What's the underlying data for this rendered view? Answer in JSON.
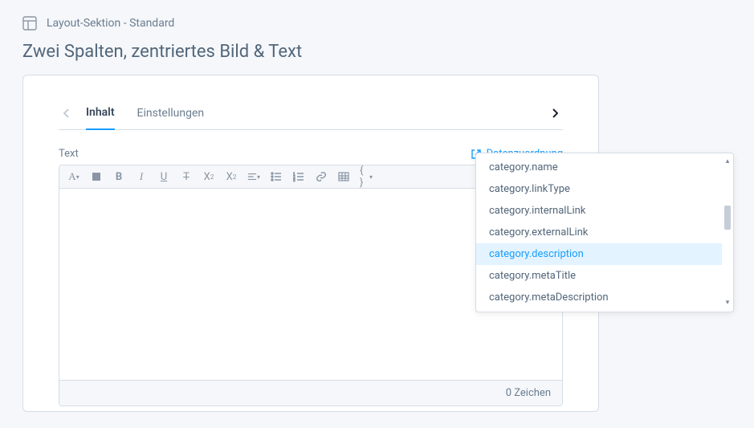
{
  "section": {
    "label": "Layout-Sektion - Standard"
  },
  "block": {
    "title": "Zwei Spalten, zentriertes Bild & Text"
  },
  "tabs": {
    "content": "Inhalt",
    "settings": "Einstellungen"
  },
  "field": {
    "label": "Text",
    "mapping_link": "Datenzuordnung"
  },
  "editor": {
    "char_count": "0 Zeichen"
  },
  "dropdown": {
    "items": [
      "category.name",
      "category.linkType",
      "category.internalLink",
      "category.externalLink",
      "category.description",
      "category.metaTitle",
      "category.metaDescription"
    ],
    "selected_index": 4
  },
  "icons": {
    "layout": "layout-icon",
    "chevron_left": "‹",
    "chevron_right": "›",
    "external": "external-link-icon",
    "scroll_up": "▴",
    "scroll_down": "▾"
  }
}
